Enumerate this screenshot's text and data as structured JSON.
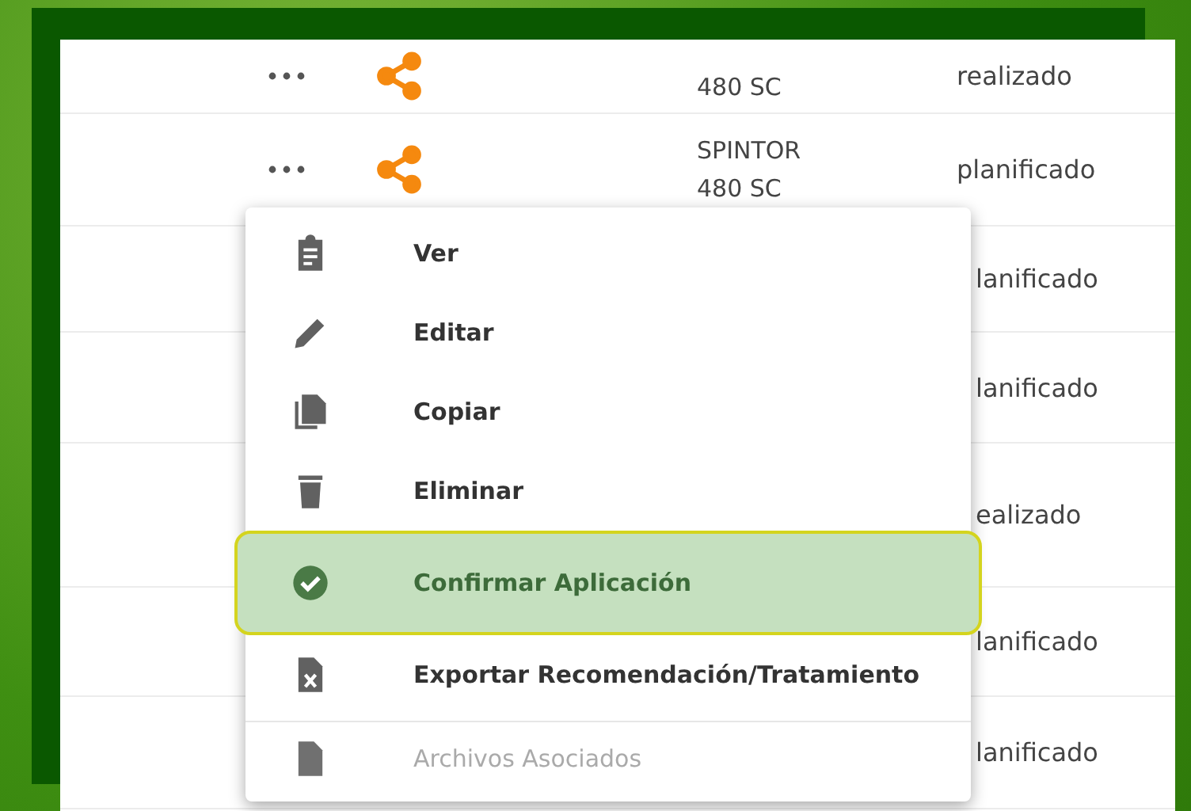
{
  "table": {
    "rows": [
      {
        "product": "480 SC",
        "status": "realizado"
      },
      {
        "product": "SPINTOR 480 SC",
        "status": "planificado"
      },
      {
        "status": "lanificado"
      },
      {
        "status": "lanificado"
      },
      {
        "status": "ealizado"
      },
      {
        "status": "lanificado"
      },
      {
        "status": "lanificado"
      }
    ]
  },
  "menu": {
    "items": [
      {
        "kind": "clipboard",
        "label": "Ver",
        "selected": false,
        "disabled": false
      },
      {
        "kind": "pencil",
        "label": "Editar",
        "selected": false,
        "disabled": false
      },
      {
        "kind": "copy",
        "label": "Copiar",
        "selected": false,
        "disabled": false
      },
      {
        "kind": "trash",
        "label": "Eliminar",
        "selected": false,
        "disabled": false
      },
      {
        "kind": "check",
        "label": "Confirmar Aplicación",
        "selected": true,
        "disabled": false
      },
      {
        "kind": "excel",
        "label": "Exportar Recomendación/Tratamiento",
        "selected": false,
        "disabled": false
      },
      {
        "kind": "file",
        "label": "Archivos Asociados",
        "selected": false,
        "disabled": true
      }
    ]
  }
}
